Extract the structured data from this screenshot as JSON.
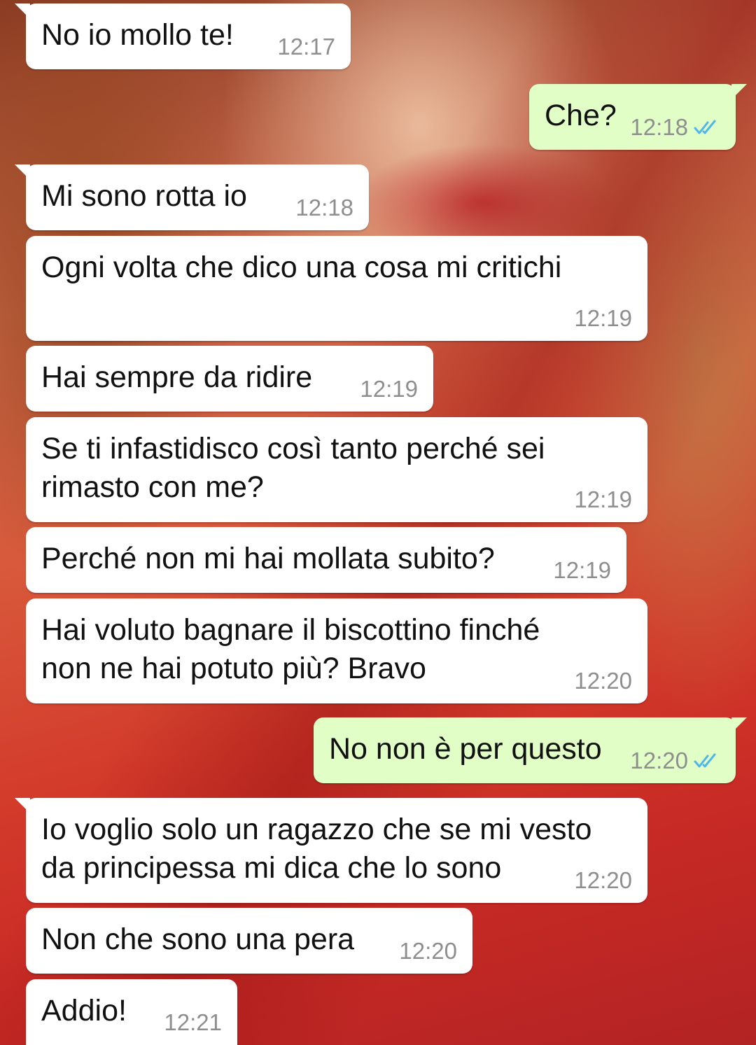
{
  "colors": {
    "incoming_bubble": "#ffffff",
    "outgoing_bubble": "#e1fec6",
    "timestamp": "#8e8e8e",
    "read_ticks": "#4fb6ec"
  },
  "messages": [
    {
      "direction": "in",
      "text": "No io mollo te!",
      "time": "12:17"
    },
    {
      "direction": "out",
      "text": "Che?",
      "time": "12:18",
      "status_icon": "double-check-read-icon"
    },
    {
      "direction": "in",
      "text": "Mi sono rotta io",
      "time": "12:18"
    },
    {
      "direction": "in",
      "text": "Ogni volta che dico una cosa mi critichi",
      "time": "12:19"
    },
    {
      "direction": "in",
      "text": "Hai sempre da ridire",
      "time": "12:19"
    },
    {
      "direction": "in",
      "text": "Se ti infastidisco così tanto perché sei\nrimasto con me?",
      "time": "12:19"
    },
    {
      "direction": "in",
      "text": "Perché non mi hai mollata subito?",
      "time": "12:19"
    },
    {
      "direction": "in",
      "text": "Hai voluto bagnare il biscottino finché\nnon ne hai potuto più? Bravo",
      "time": "12:20"
    },
    {
      "direction": "out",
      "text": "No non è per questo",
      "time": "12:20",
      "status_icon": "double-check-read-icon"
    },
    {
      "direction": "in",
      "text": "Io voglio solo un ragazzo che se mi vesto\nda principessa mi dica che lo sono",
      "time": "12:20"
    },
    {
      "direction": "in",
      "text": "Non che sono una pera",
      "time": "12:20"
    },
    {
      "direction": "in",
      "text": "Addio!",
      "time": "12:21"
    }
  ]
}
